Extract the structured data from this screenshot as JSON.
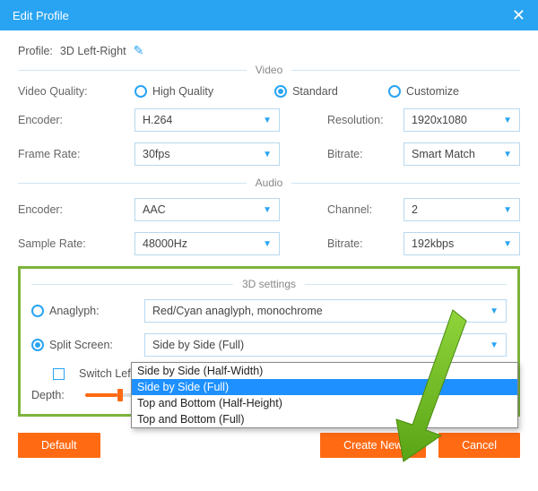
{
  "title": "Edit Profile",
  "profile": {
    "label": "Profile:",
    "value": "3D Left-Right"
  },
  "sections": {
    "video": "Video",
    "audio": "Audio",
    "three_d": "3D settings"
  },
  "video": {
    "quality_label": "Video Quality:",
    "quality_options": {
      "high": "High Quality",
      "standard": "Standard",
      "customize": "Customize"
    },
    "quality_selected": "standard",
    "encoder_label": "Encoder:",
    "encoder_value": "H.264",
    "resolution_label": "Resolution:",
    "resolution_value": "1920x1080",
    "framerate_label": "Frame Rate:",
    "framerate_value": "30fps",
    "bitrate_label": "Bitrate:",
    "bitrate_value": "Smart Match"
  },
  "audio": {
    "encoder_label": "Encoder:",
    "encoder_value": "AAC",
    "channel_label": "Channel:",
    "channel_value": "2",
    "samplerate_label": "Sample Rate:",
    "samplerate_value": "48000Hz",
    "bitrate_label": "Bitrate:",
    "bitrate_value": "192kbps"
  },
  "three_d": {
    "anaglyph_label": "Anaglyph:",
    "anaglyph_value": "Red/Cyan anaglyph, monochrome",
    "split_label": "Split Screen:",
    "split_value": "Side by Side (Full)",
    "split_options": [
      "Side by Side (Half-Width)",
      "Side by Side (Full)",
      "Top and Bottom (Half-Height)",
      "Top and Bottom (Full)"
    ],
    "split_selected_index": 1,
    "mode_selected": "split",
    "switch_label": "Switch Left",
    "depth_label": "Depth:"
  },
  "buttons": {
    "default": "Default",
    "create": "Create New",
    "cancel": "Cancel"
  }
}
